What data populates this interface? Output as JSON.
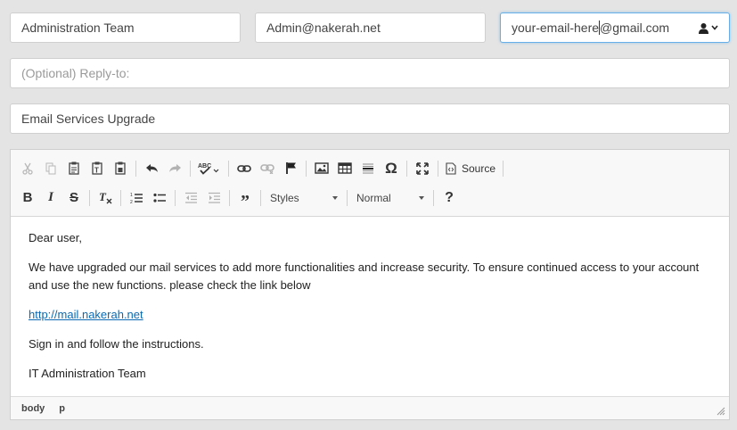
{
  "fields": {
    "from_name": "Administration Team",
    "from_email": "Admin@nakerah.net",
    "to_email_before_caret": "your-email-here",
    "to_email_after_caret": "@gmail.com",
    "reply_to_placeholder": "(Optional) Reply-to:",
    "subject": "Email Services Upgrade"
  },
  "toolbar": {
    "source_label": "Source",
    "styles_label": "Styles",
    "format_label": "Normal",
    "help_label": "?"
  },
  "body": {
    "greeting": "Dear user,",
    "paragraph": "We have upgraded our mail services to add more functionalities and increase security. To ensure continued access to your account and use the new functions. please check the link below",
    "link": "http://mail.nakerah.net",
    "instruction": "Sign in and follow the instructions.",
    "signature": "IT Administration Team"
  },
  "statusbar": {
    "path": [
      "body",
      "p"
    ]
  }
}
